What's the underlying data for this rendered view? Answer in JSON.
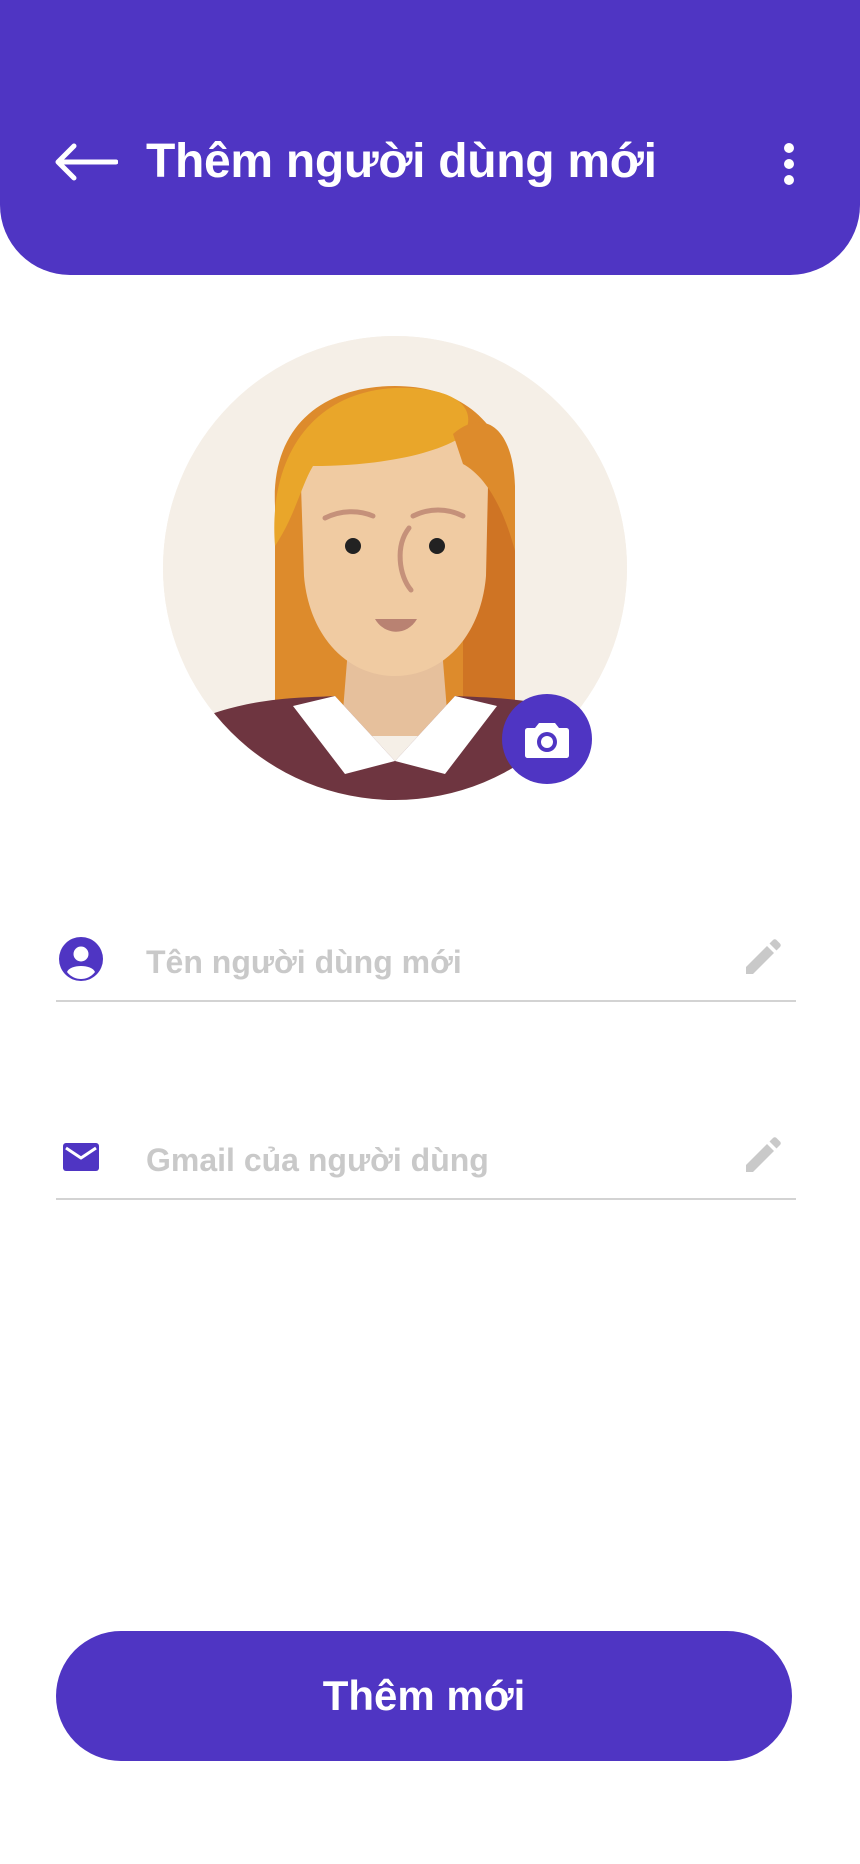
{
  "header": {
    "title": "Thêm người dùng mới",
    "back_icon": "arrow-left-icon",
    "menu_icon": "more-vertical-icon",
    "background_color": "#4f35c3"
  },
  "avatar": {
    "icon": "user-avatar-illustration",
    "camera_icon": "camera-icon"
  },
  "form": {
    "name_field": {
      "icon": "account-circle-icon",
      "placeholder": "Tên người dùng mới",
      "value": "",
      "edit_icon": "pencil-icon"
    },
    "email_field": {
      "icon": "mail-icon",
      "placeholder": "Gmail của người dùng",
      "value": "",
      "edit_icon": "pencil-icon"
    }
  },
  "submit": {
    "label": "Thêm mới",
    "color": "#4f35c3"
  }
}
